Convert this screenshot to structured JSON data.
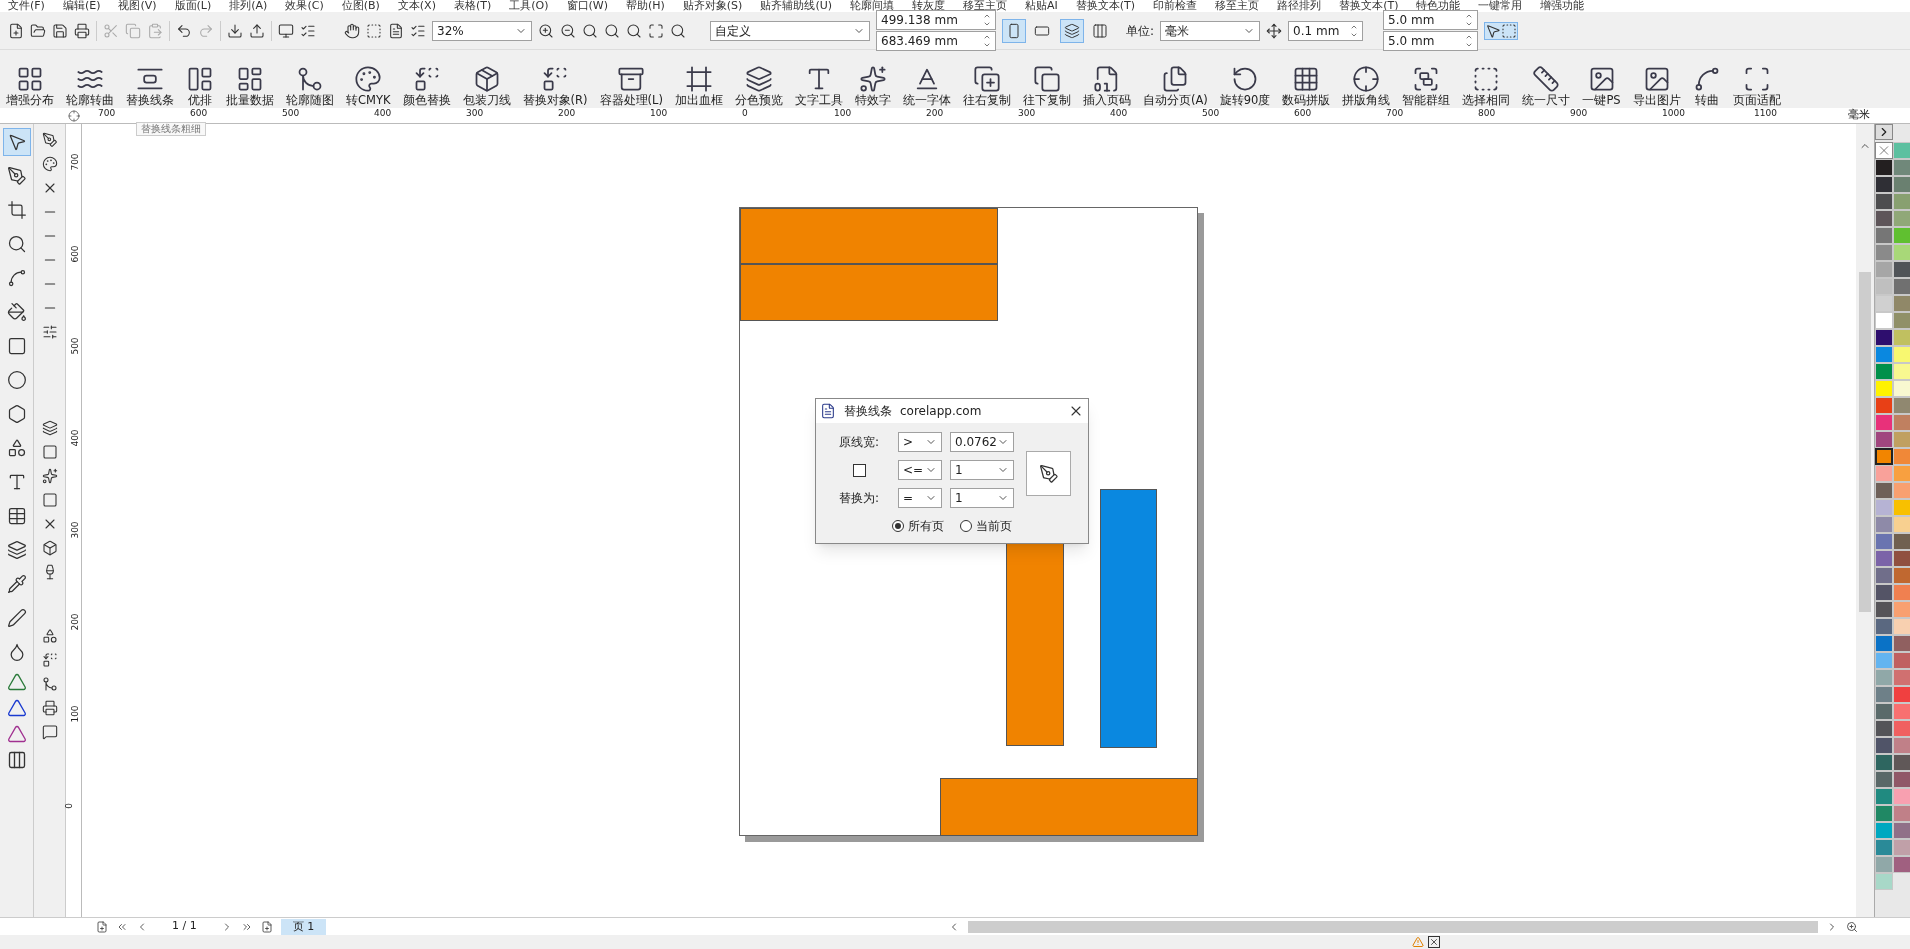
{
  "menu": [
    "文件(F)",
    "编辑(E)",
    "视图(V)",
    "版面(L)",
    "排列(A)",
    "效果(C)",
    "位图(B)",
    "文本(X)",
    "表格(T)",
    "工具(O)",
    "窗口(W)",
    "帮助(H)",
    "贴齐对象(S)",
    "贴齐辅助线(U)",
    "轮廓间填",
    "转灰度",
    "移至主页",
    "粘贴AI",
    "替换文本(T)",
    "印前检查",
    "移至主页",
    "路径排列",
    "替换文本(T)",
    "特色功能",
    "一键常用",
    "增强功能"
  ],
  "toolbar": {
    "zoom": "32%",
    "page_size": "自定义",
    "width": "499.138 mm",
    "height": "683.469 mm",
    "orientation": [
      {
        "selected": true
      },
      {
        "selected": false
      }
    ],
    "page_mode": [
      {
        "selected": true
      },
      {
        "selected": false
      }
    ],
    "units_label": "单位:",
    "units": "毫米",
    "nudge": "0.1 mm",
    "dup_x": "5.0 mm",
    "dup_y": "5.0 mm"
  },
  "plugin_bar": [
    {
      "label": "增强分布"
    },
    {
      "label": "轮廓转曲"
    },
    {
      "label": "替换线条"
    },
    {
      "label": "优排"
    },
    {
      "label": "批量数据"
    },
    {
      "label": "轮廓随图"
    },
    {
      "label": "转CMYK"
    },
    {
      "label": "颜色替换"
    },
    {
      "label": "包装刀线"
    },
    {
      "label": "替换对象(R)"
    },
    {
      "label": "容器处理(L)"
    },
    {
      "label": "加出血框"
    },
    {
      "label": "分色预览"
    },
    {
      "label": "文字工具"
    },
    {
      "label": "特效字"
    },
    {
      "label": "统一字体"
    },
    {
      "label": "往右复制"
    },
    {
      "label": "往下复制"
    },
    {
      "label": "插入页码"
    },
    {
      "label": "自动分页(A)"
    },
    {
      "label": "旋转90度"
    },
    {
      "label": "数码拼版"
    },
    {
      "label": "拼版角线"
    },
    {
      "label": "智能群组"
    },
    {
      "label": "选择相同"
    },
    {
      "label": "统一尺寸"
    },
    {
      "label": "一键PS"
    },
    {
      "label": "导出图片"
    },
    {
      "label": "转曲"
    },
    {
      "label": "页面适配"
    }
  ],
  "tooltip": "替换线条粗细",
  "ruler": {
    "unit": "毫米",
    "horizontal": [
      "700",
      "600",
      "500",
      "400",
      "300",
      "200",
      "100",
      "0",
      "100",
      "200",
      "300",
      "400",
      "500",
      "600",
      "700",
      "800",
      "900",
      "1000",
      "1100"
    ],
    "vertical": [
      "700",
      "600",
      "500",
      "400",
      "300",
      "200",
      "100",
      "0"
    ]
  },
  "toolbox": [
    {
      "selected": true
    },
    {
      "selected": false
    },
    {
      "selected": false
    },
    {
      "selected": false
    },
    {
      "selected": false
    },
    {
      "selected": false
    },
    {
      "selected": false
    },
    {
      "selected": false
    },
    {
      "selected": false
    },
    {
      "selected": false
    },
    {
      "selected": false
    },
    {
      "selected": false
    },
    {
      "selected": false
    },
    {
      "selected": false
    },
    {
      "selected": false
    },
    {
      "selected": false
    }
  ],
  "dialog": {
    "title": "替换线条",
    "site": "corelapp.com",
    "rows": [
      {
        "kind": "label",
        "label": "原线宽:",
        "op": ">",
        "value": "0.0762"
      },
      {
        "kind": "checkbox",
        "checked": false,
        "op": "<=",
        "value": "1"
      },
      {
        "kind": "label",
        "label": "替换为:",
        "op": "=",
        "value": "1"
      }
    ],
    "radios": [
      {
        "label": "所有页",
        "selected": true
      },
      {
        "label": "当前页",
        "selected": false
      }
    ]
  },
  "pages": {
    "counter": "1 / 1",
    "tabs": [
      {
        "label": "页 1",
        "selected": true
      }
    ]
  },
  "palette": {
    "columns": [
      [
        {
          "color": "#231f20",
          "selected": false
        },
        {
          "color": "#2f2f35",
          "selected": false
        },
        {
          "color": "#4d4d4f",
          "selected": false
        },
        {
          "color": "#5e5559",
          "selected": false
        },
        {
          "color": "#767676",
          "selected": false
        },
        {
          "color": "#8a8a8a",
          "selected": false
        },
        {
          "color": "#a6a6a6",
          "selected": false
        },
        {
          "color": "#bfbfbf",
          "selected": false
        },
        {
          "color": "#d0d0d0",
          "selected": false
        },
        {
          "color": "#ffffff",
          "selected": false
        },
        {
          "color": "#2e0e6e",
          "selected": false
        },
        {
          "color": "#0a88e0",
          "selected": false
        },
        {
          "color": "#00904a",
          "selected": false
        },
        {
          "color": "#fff200",
          "selected": false
        },
        {
          "color": "#e84016",
          "selected": false
        },
        {
          "color": "#e8317a",
          "selected": false
        },
        {
          "color": "#a0467e",
          "selected": false
        },
        {
          "color": "#f28500",
          "selected": true
        },
        {
          "color": "#f9a19a",
          "selected": false
        },
        {
          "color": "#6e6058",
          "selected": false
        },
        {
          "color": "#b6b3d4",
          "selected": false
        },
        {
          "color": "#8e8aa8",
          "selected": false
        },
        {
          "color": "#6a74b0",
          "selected": false
        },
        {
          "color": "#7b63a8",
          "selected": false
        },
        {
          "color": "#706e8a",
          "selected": false
        },
        {
          "color": "#545466",
          "selected": false
        },
        {
          "color": "#565458",
          "selected": false
        },
        {
          "color": "#5a6880",
          "selected": false
        },
        {
          "color": "#0a72c6",
          "selected": false
        },
        {
          "color": "#63b4f0",
          "selected": false
        },
        {
          "color": "#90a8a8",
          "selected": false
        },
        {
          "color": "#6e8088",
          "selected": false
        },
        {
          "color": "#5a6a6a",
          "selected": false
        },
        {
          "color": "#545458",
          "selected": false
        },
        {
          "color": "#505468",
          "selected": false
        },
        {
          "color": "#2e6660",
          "selected": false
        },
        {
          "color": "#5a6868",
          "selected": false
        },
        {
          "color": "#208a80",
          "selected": false
        },
        {
          "color": "#208864",
          "selected": false
        },
        {
          "color": "#00a8c0",
          "selected": false
        },
        {
          "color": "#2a8a98",
          "selected": false
        },
        {
          "color": "#90a8a8",
          "selected": false
        },
        {
          "color": "#a8d8c8",
          "selected": false
        }
      ],
      [
        {
          "color": "#5cc0a0",
          "selected": false
        },
        {
          "color": "#70887a",
          "selected": false
        },
        {
          "color": "#6a8070",
          "selected": false
        },
        {
          "color": "#88a070",
          "selected": false
        },
        {
          "color": "#90a878",
          "selected": false
        },
        {
          "color": "#60c030",
          "selected": false
        },
        {
          "color": "#a8d878",
          "selected": false
        },
        {
          "color": "#505458",
          "selected": false
        },
        {
          "color": "#707070",
          "selected": false
        },
        {
          "color": "#908868",
          "selected": false
        },
        {
          "color": "#909068",
          "selected": false
        },
        {
          "color": "#c0c060",
          "selected": false
        },
        {
          "color": "#f8f870",
          "selected": false
        },
        {
          "color": "#f8f890",
          "selected": false
        },
        {
          "color": "#f8f8d0",
          "selected": false
        },
        {
          "color": "#908870",
          "selected": false
        },
        {
          "color": "#c08060",
          "selected": false
        },
        {
          "color": "#c0a060",
          "selected": false
        },
        {
          "color": "#f08838",
          "selected": false
        },
        {
          "color": "#f8a040",
          "selected": false
        },
        {
          "color": "#f8a070",
          "selected": false
        },
        {
          "color": "#f8c000",
          "selected": false
        },
        {
          "color": "#f8d090",
          "selected": false
        },
        {
          "color": "#706050",
          "selected": false
        },
        {
          "color": "#905040",
          "selected": false
        },
        {
          "color": "#c06830",
          "selected": false
        },
        {
          "color": "#f08050",
          "selected": false
        },
        {
          "color": "#f8a070",
          "selected": false
        },
        {
          "color": "#f8d0b0",
          "selected": false
        },
        {
          "color": "#906060",
          "selected": false
        },
        {
          "color": "#c06060",
          "selected": false
        },
        {
          "color": "#d07070",
          "selected": false
        },
        {
          "color": "#f04040",
          "selected": false
        },
        {
          "color": "#f87070",
          "selected": false
        },
        {
          "color": "#f06060",
          "selected": false
        },
        {
          "color": "#c08088",
          "selected": false
        },
        {
          "color": "#605858",
          "selected": false
        },
        {
          "color": "#905868",
          "selected": false
        },
        {
          "color": "#f8a0b0",
          "selected": false
        },
        {
          "color": "#c08088",
          "selected": false
        },
        {
          "color": "#907088",
          "selected": false
        },
        {
          "color": "#c0a0a8",
          "selected": false
        },
        {
          "color": "#a06080",
          "selected": false
        }
      ]
    ]
  }
}
